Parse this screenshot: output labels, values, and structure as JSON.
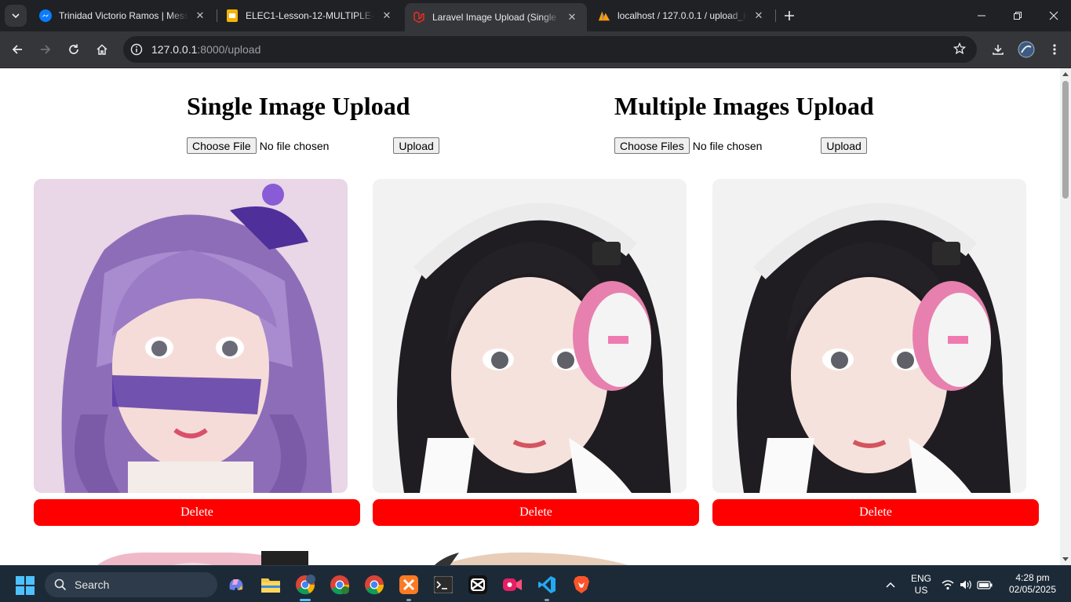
{
  "browser": {
    "tabs": [
      {
        "title": "Trinidad Victorio Ramos | Messenger",
        "favicon": "messenger-icon",
        "active": false
      },
      {
        "title": "ELEC1-Lesson-12-MULTIPLE-PHP",
        "favicon": "slides-icon",
        "active": false
      },
      {
        "title": "Laravel Image Upload (Single + Multiple)",
        "favicon": "laravel-icon",
        "active": true
      },
      {
        "title": "localhost / 127.0.0.1 / upload_images",
        "favicon": "phpmyadmin-icon",
        "active": false
      }
    ],
    "url_host": "127.0.0.1",
    "url_rest": ":8000/upload"
  },
  "page": {
    "single": {
      "heading": "Single Image Upload",
      "choose_label": "Choose File",
      "file_status": "No file chosen",
      "upload_label": "Upload"
    },
    "multiple": {
      "heading": "Multiple Images Upload",
      "choose_label": "Choose Files",
      "file_status": "No file chosen",
      "upload_label": "Upload"
    },
    "images": [
      {
        "subject": "purple-haired anime girl with bow",
        "delete_label": "Delete"
      },
      {
        "subject": "black-haired anime girl with headphones",
        "delete_label": "Delete"
      },
      {
        "subject": "black-haired anime girl with headphones",
        "delete_label": "Delete"
      }
    ],
    "accent_colors": {
      "delete": "#ff0000"
    }
  },
  "taskbar": {
    "search_placeholder": "Search",
    "language_line1": "ENG",
    "language_line2": "US",
    "time": "4:28 pm",
    "date": "02/05/2025"
  }
}
